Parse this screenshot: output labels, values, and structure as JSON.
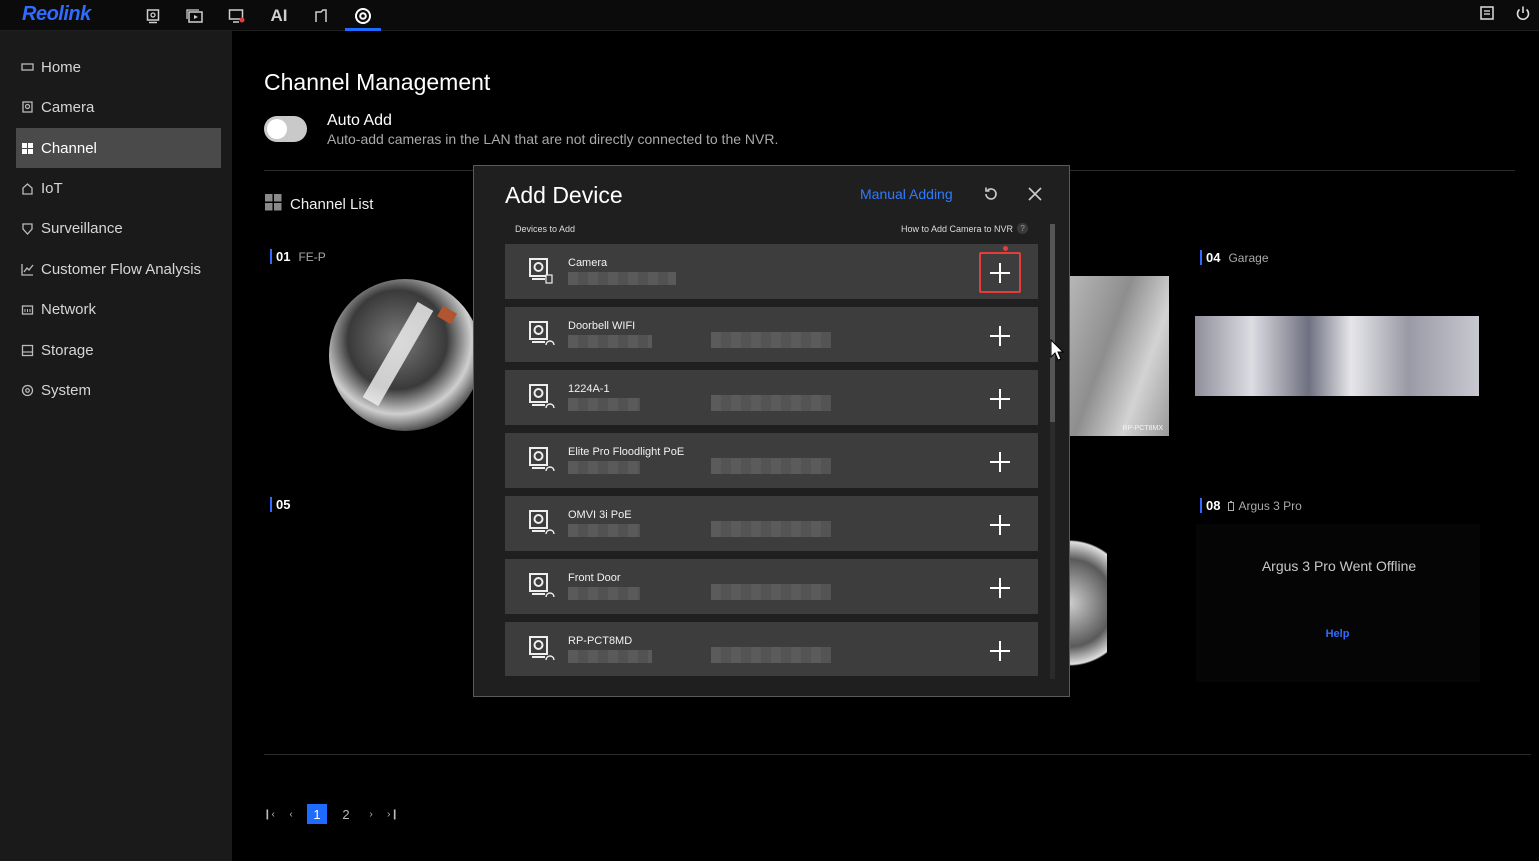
{
  "app": {
    "logo": "Reolink"
  },
  "topnav": {
    "ai_label": "AI"
  },
  "sidebar": {
    "items": [
      {
        "label": "Home",
        "icon": "monitor-icon"
      },
      {
        "label": "Camera",
        "icon": "camera-icon"
      },
      {
        "label": "Channel",
        "icon": "grid-icon",
        "active": true
      },
      {
        "label": "IoT",
        "icon": "home-icon"
      },
      {
        "label": "Surveillance",
        "icon": "shield-icon"
      },
      {
        "label": "Customer Flow Analysis",
        "icon": "chart-icon"
      },
      {
        "label": "Network",
        "icon": "network-icon"
      },
      {
        "label": "Storage",
        "icon": "storage-icon"
      },
      {
        "label": "System",
        "icon": "gear-icon"
      }
    ]
  },
  "main": {
    "title": "Channel Management",
    "auto_add": {
      "title": "Auto Add",
      "description": "Auto-add cameras in the LAN that are not directly connected to the NVR.",
      "enabled": false
    },
    "channel_list_label": "Channel List",
    "channels": [
      {
        "num": "01",
        "name": "FE-P"
      },
      {
        "num": "04",
        "name": "Garage"
      },
      {
        "num": "05",
        "name": ""
      },
      {
        "num": "08",
        "name": "Argus 3 Pro"
      }
    ],
    "cam3_label": "RP-PCT8MX",
    "offline_message": "Argus 3 Pro Went Offline",
    "help_label": "Help",
    "pagination": {
      "pages": [
        "1",
        "2"
      ],
      "current": "1"
    }
  },
  "dialog": {
    "title": "Add Device",
    "manual_adding": "Manual Adding",
    "devices_to_add": "Devices to Add",
    "how_to": "How to Add Camera to NVR",
    "help_mark": "?",
    "devices": [
      {
        "name": "Camera"
      },
      {
        "name": "Doorbell WIFI"
      },
      {
        "name": "1224A-1"
      },
      {
        "name": "Elite Pro Floodlight PoE"
      },
      {
        "name": "OMVI 3i PoE"
      },
      {
        "name": "Front Door"
      },
      {
        "name": "RP-PCT8MD"
      }
    ]
  },
  "colors": {
    "accent": "#1e6bff",
    "highlight": "#e53c3c",
    "row_bg": "#3d3d3d"
  }
}
